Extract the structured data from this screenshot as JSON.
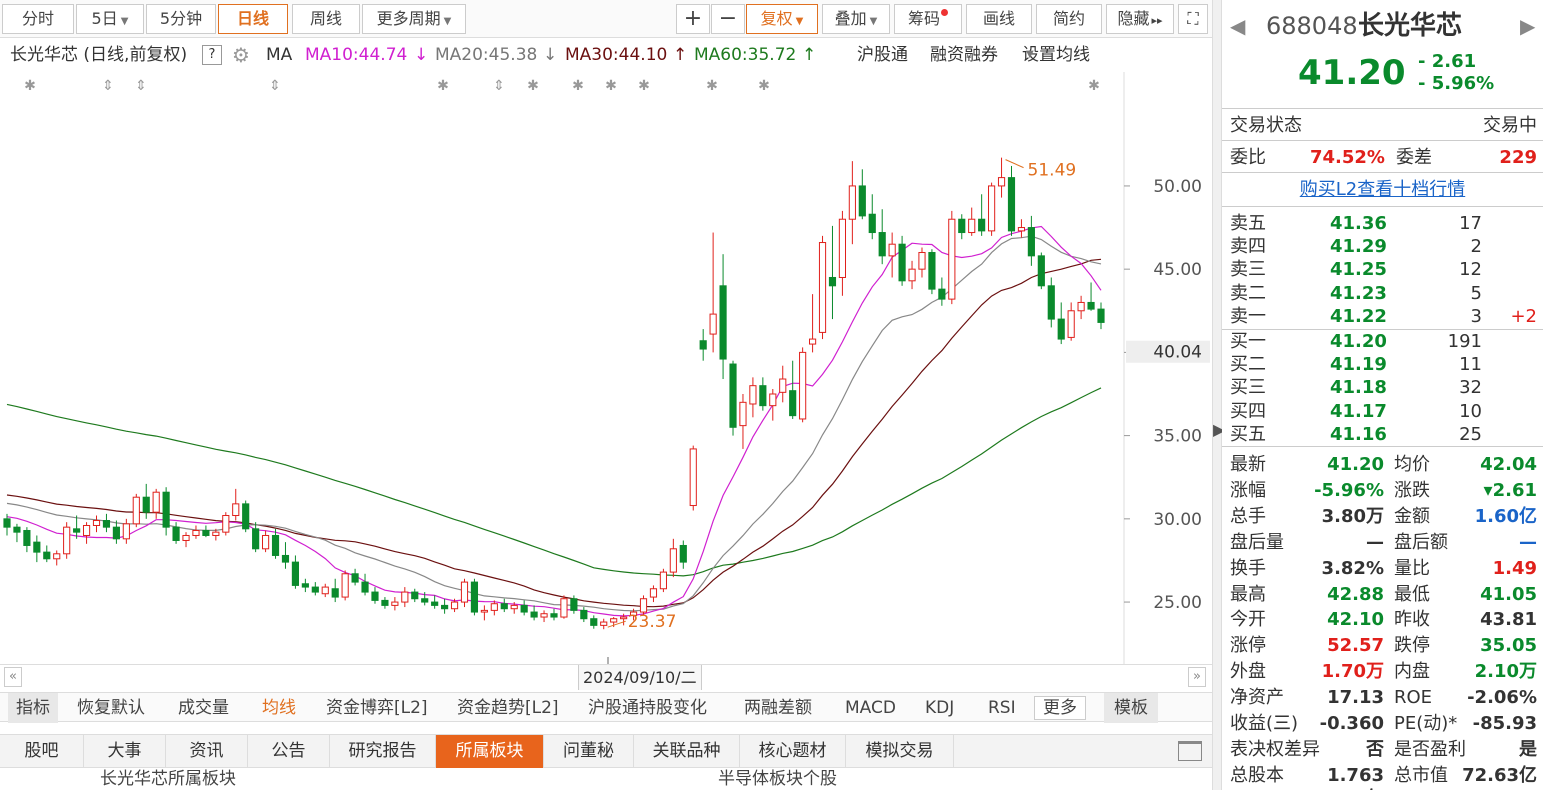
{
  "toolbar": {
    "buttons": [
      "分时",
      "5日",
      "5分钟",
      "日线",
      "周线",
      "更多周期"
    ],
    "active": "日线",
    "right": [
      "+",
      "−",
      "复权",
      "叠加",
      "筹码",
      "画线",
      "简约",
      "隐藏"
    ],
    "right_more": "▸▸",
    "fullscreen": "⛶"
  },
  "info": {
    "title": "长光华芯 (日线,前复权)",
    "help": "?",
    "ma": "MA",
    "ma10": "MA10:44.74",
    "ma10_arrow": "↓",
    "ma20": "MA20:45.38",
    "ma20_arrow": "↓",
    "ma30": "MA30:44.10",
    "ma30_arrow": "↑",
    "ma60": "MA60:35.72",
    "ma60_arrow": "↑",
    "hgt": "沪股通",
    "rzrq": "融资融券",
    "setma": "设置均线"
  },
  "colors": {
    "up": "#e0201b",
    "down": "#0a8a2c",
    "ma10": "#d020d0",
    "ma20": "#888888",
    "ma30": "#6b1010",
    "ma60": "#1e7a1e",
    "accent": "#e07020"
  },
  "chart_data": {
    "type": "candlestick",
    "y_ticks": [
      50.0,
      45.0,
      40.0,
      35.0,
      30.0,
      25.0
    ],
    "ylim": [
      22.0,
      53.0
    ],
    "current_price_label": "40.04",
    "high_label": "51.49",
    "low_label": "23.37",
    "date_label": "2024/09/10/二",
    "candles": [
      [
        30.0,
        30.3,
        29.0,
        29.5
      ],
      [
        29.5,
        29.7,
        28.6,
        29.2
      ],
      [
        29.3,
        29.5,
        28.0,
        28.4
      ],
      [
        28.6,
        29.0,
        27.4,
        28.0
      ],
      [
        28.0,
        28.4,
        27.4,
        27.6
      ],
      [
        27.6,
        28.1,
        27.2,
        27.9
      ],
      [
        27.9,
        29.8,
        27.6,
        29.5
      ],
      [
        29.4,
        30.2,
        28.8,
        29.2
      ],
      [
        29.0,
        29.8,
        28.5,
        29.6
      ],
      [
        29.6,
        30.2,
        29.2,
        29.9
      ],
      [
        29.9,
        30.3,
        29.2,
        29.5
      ],
      [
        29.5,
        29.9,
        28.5,
        28.8
      ],
      [
        28.8,
        30.0,
        28.5,
        29.7
      ],
      [
        29.7,
        31.5,
        29.5,
        31.3
      ],
      [
        31.3,
        32.1,
        30.0,
        30.4
      ],
      [
        30.4,
        31.8,
        30.0,
        31.6
      ],
      [
        31.6,
        31.9,
        29.0,
        29.5
      ],
      [
        29.5,
        29.8,
        28.5,
        28.7
      ],
      [
        28.7,
        29.2,
        28.3,
        29.0
      ],
      [
        29.0,
        29.6,
        28.8,
        29.3
      ],
      [
        29.3,
        29.6,
        28.9,
        29.0
      ],
      [
        29.0,
        29.4,
        28.7,
        29.2
      ],
      [
        29.2,
        30.4,
        29.0,
        30.2
      ],
      [
        30.2,
        31.8,
        29.9,
        30.9
      ],
      [
        30.9,
        31.1,
        29.2,
        29.4
      ],
      [
        29.4,
        29.8,
        28.0,
        28.2
      ],
      [
        28.2,
        29.3,
        28.0,
        29.0
      ],
      [
        29.0,
        29.4,
        27.6,
        27.8
      ],
      [
        27.8,
        28.6,
        27.0,
        27.4
      ],
      [
        27.4,
        27.8,
        25.8,
        26.0
      ],
      [
        26.1,
        26.4,
        25.6,
        25.9
      ],
      [
        25.9,
        26.2,
        25.4,
        25.6
      ],
      [
        25.5,
        26.1,
        25.3,
        25.9
      ],
      [
        25.8,
        26.4,
        25.0,
        25.3
      ],
      [
        25.3,
        26.9,
        25.1,
        26.7
      ],
      [
        26.7,
        27.0,
        26.0,
        26.2
      ],
      [
        26.2,
        26.7,
        25.4,
        25.6
      ],
      [
        25.6,
        25.9,
        24.9,
        25.1
      ],
      [
        25.1,
        25.3,
        24.6,
        24.8
      ],
      [
        24.8,
        25.3,
        24.5,
        25.0
      ],
      [
        25.0,
        25.9,
        24.7,
        25.6
      ],
      [
        25.6,
        25.8,
        25.0,
        25.2
      ],
      [
        25.2,
        25.6,
        24.8,
        25.0
      ],
      [
        25.0,
        25.4,
        24.6,
        24.8
      ],
      [
        24.8,
        25.2,
        24.3,
        24.6
      ],
      [
        24.6,
        25.2,
        24.4,
        25.0
      ],
      [
        25.0,
        26.4,
        24.7,
        26.2
      ],
      [
        26.2,
        26.4,
        24.2,
        24.4
      ],
      [
        24.4,
        24.8,
        23.9,
        24.5
      ],
      [
        24.5,
        25.1,
        24.2,
        24.9
      ],
      [
        24.9,
        25.2,
        24.4,
        24.6
      ],
      [
        24.6,
        25.0,
        24.3,
        24.8
      ],
      [
        24.8,
        25.1,
        24.2,
        24.4
      ],
      [
        24.4,
        24.8,
        23.9,
        24.1
      ],
      [
        24.1,
        24.5,
        23.8,
        24.3
      ],
      [
        24.3,
        24.6,
        23.9,
        24.1
      ],
      [
        24.1,
        25.4,
        24.0,
        25.2
      ],
      [
        25.2,
        25.4,
        24.3,
        24.5
      ],
      [
        24.5,
        24.7,
        23.8,
        24.0
      ],
      [
        24.0,
        24.2,
        23.4,
        23.6
      ],
      [
        23.6,
        24.0,
        23.37,
        23.8
      ],
      [
        23.8,
        24.1,
        23.5,
        24.0
      ],
      [
        24.0,
        24.3,
        23.6,
        24.1
      ],
      [
        24.2,
        24.6,
        23.9,
        24.4
      ],
      [
        24.4,
        25.4,
        24.2,
        25.2
      ],
      [
        25.3,
        26.0,
        25.0,
        25.8
      ],
      [
        25.8,
        27.0,
        25.6,
        26.8
      ],
      [
        26.8,
        28.8,
        26.5,
        28.2
      ],
      [
        28.4,
        28.7,
        27.0,
        27.4
      ],
      [
        30.8,
        34.4,
        30.5,
        34.2
      ],
      [
        40.7,
        41.4,
        39.5,
        40.2
      ],
      [
        41.1,
        47.2,
        40.0,
        42.3
      ],
      [
        44.0,
        45.9,
        38.4,
        39.6
      ],
      [
        39.3,
        39.5,
        35.0,
        35.5
      ],
      [
        35.6,
        37.5,
        34.2,
        37.0
      ],
      [
        36.9,
        38.5,
        36.1,
        38.0
      ],
      [
        38.0,
        38.5,
        36.5,
        36.8
      ],
      [
        36.8,
        37.8,
        35.9,
        37.5
      ],
      [
        37.6,
        39.2,
        37.0,
        38.4
      ],
      [
        37.7,
        39.5,
        36.0,
        36.2
      ],
      [
        36.0,
        40.3,
        35.8,
        40.0
      ],
      [
        40.5,
        43.5,
        40.0,
        40.8
      ],
      [
        41.2,
        47.0,
        40.8,
        46.6
      ],
      [
        44.5,
        47.6,
        42.0,
        44.0
      ],
      [
        44.5,
        48.5,
        43.4,
        48.0
      ],
      [
        48.0,
        51.49,
        46.5,
        50.0
      ],
      [
        50.0,
        51.0,
        48.0,
        48.2
      ],
      [
        48.3,
        49.5,
        46.8,
        47.2
      ],
      [
        47.2,
        48.6,
        45.3,
        45.8
      ],
      [
        45.8,
        47.2,
        44.5,
        46.5
      ],
      [
        46.5,
        47.0,
        44.0,
        44.3
      ],
      [
        44.3,
        45.5,
        43.8,
        45.0
      ],
      [
        45.0,
        46.3,
        44.5,
        46.0
      ],
      [
        46.0,
        46.2,
        43.5,
        43.8
      ],
      [
        43.8,
        44.5,
        42.8,
        43.2
      ],
      [
        43.2,
        48.5,
        42.9,
        48.0
      ],
      [
        48.0,
        48.3,
        46.8,
        47.2
      ],
      [
        47.2,
        48.7,
        47.0,
        48.0
      ],
      [
        48.0,
        49.5,
        47.0,
        47.3
      ],
      [
        47.3,
        50.2,
        47.0,
        50.0
      ],
      [
        50.0,
        51.7,
        49.3,
        50.5
      ],
      [
        50.5,
        51.2,
        47.0,
        47.3
      ],
      [
        47.3,
        48.0,
        46.9,
        47.5
      ],
      [
        47.5,
        48.2,
        45.2,
        45.8
      ],
      [
        45.8,
        46.0,
        43.8,
        44.0
      ],
      [
        44.0,
        44.5,
        41.5,
        42.0
      ],
      [
        42.0,
        43.0,
        40.5,
        40.8
      ],
      [
        40.9,
        43.0,
        40.7,
        42.5
      ],
      [
        42.5,
        43.4,
        42.0,
        43.0
      ],
      [
        43.0,
        44.2,
        42.5,
        42.6
      ],
      [
        42.6,
        43.0,
        41.4,
        41.8
      ]
    ]
  },
  "indicators": {
    "items": [
      "指标",
      "恢复默认",
      "成交量",
      "均线",
      "资金博弈[L2]",
      "资金趋势[L2]",
      "沪股通持股变化",
      "两融差额",
      "MACD",
      "KDJ",
      "RSI",
      "更多",
      "模板"
    ],
    "active": "均线"
  },
  "tabs": {
    "items": [
      "股吧",
      "大事",
      "资讯",
      "公告",
      "研究报告",
      "所属板块",
      "问董秘",
      "关联品种",
      "核心题材",
      "模拟交易"
    ],
    "active": "所属板块"
  },
  "subtabs": {
    "left": "长光华芯所属板块",
    "right": "半导体板块个股"
  },
  "quote": {
    "code": "688048",
    "name": "长光华芯",
    "price": "41.20",
    "change": "- 2.61",
    "pct": "- 5.96%",
    "status_label": "交易状态",
    "status_value": "交易中",
    "wb_label": "委比",
    "wb_value": "74.52%",
    "wc_label": "委差",
    "wc_value": "229",
    "l2_link": "购买L2查看十档行情",
    "asks": [
      [
        "卖五",
        "41.36",
        "17",
        ""
      ],
      [
        "卖四",
        "41.29",
        "2",
        ""
      ],
      [
        "卖三",
        "41.25",
        "12",
        ""
      ],
      [
        "卖二",
        "41.23",
        "5",
        ""
      ],
      [
        "卖一",
        "41.22",
        "3",
        "+2"
      ]
    ],
    "bids": [
      [
        "买一",
        "41.20",
        "191",
        ""
      ],
      [
        "买二",
        "41.19",
        "11",
        ""
      ],
      [
        "买三",
        "41.18",
        "32",
        ""
      ],
      [
        "买四",
        "41.17",
        "10",
        ""
      ],
      [
        "买五",
        "41.16",
        "25",
        ""
      ]
    ],
    "stats": [
      [
        "最新",
        "41.20",
        "g",
        "均价",
        "42.04",
        "g"
      ],
      [
        "涨幅",
        "-5.96%",
        "g",
        "涨跌",
        "▾2.61",
        "g"
      ],
      [
        "总手",
        "3.80万",
        "k",
        "金额",
        "1.60亿",
        "b"
      ],
      [
        "盘后量",
        "—",
        "k",
        "盘后额",
        "—",
        "b"
      ],
      [
        "换手",
        "3.82%",
        "k",
        "量比",
        "1.49",
        "r"
      ],
      [
        "最高",
        "42.88",
        "g",
        "最低",
        "41.05",
        "g"
      ],
      [
        "今开",
        "42.10",
        "g",
        "昨收",
        "43.81",
        "k"
      ],
      [
        "涨停",
        "52.57",
        "r",
        "跌停",
        "35.05",
        "g"
      ],
      [
        "外盘",
        "1.70万",
        "r",
        "内盘",
        "2.10万",
        "g"
      ],
      [
        "净资产",
        "17.13",
        "k",
        "ROE",
        "-2.06%",
        "k"
      ],
      [
        "收益(㆔)",
        "-0.360",
        "k",
        "PE(动)*",
        "-85.93",
        "k"
      ],
      [
        "表决权差异",
        "否",
        "k",
        "是否盈利",
        "是",
        "k"
      ],
      [
        "总股本",
        "1.763亿",
        "k",
        "总市值",
        "72.63亿",
        "k"
      ]
    ]
  }
}
